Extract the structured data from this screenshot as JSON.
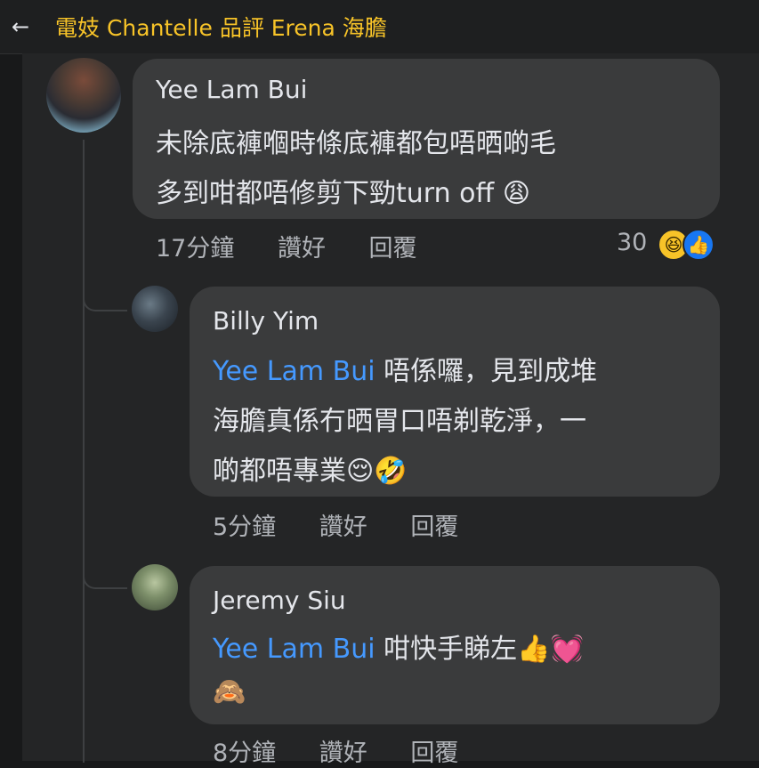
{
  "header": {
    "back_icon": "←",
    "title": "電妓 Chantelle 品評 Erena 海膽"
  },
  "comment": {
    "author": "Yee Lam Bui",
    "lines": [
      "未除底褲嗰時條底褲都包唔晒啲毛",
      "多到咁都唔￼修剪下勁turn off"
    ],
    "emoji_end": "😩",
    "time": "17分鐘",
    "like_label": "讚好",
    "reply_label": "回覆",
    "reaction_count": "30",
    "reaction_icons": [
      "laugh-icon",
      "like-icon"
    ]
  },
  "replies": [
    {
      "author": "Billy Yim",
      "mention": "Yee Lam Bui",
      "lines": [
        " 唔係囉，見到成堆",
        "海膽真係冇晒胃口唔剃乾淨，一",
        "啲都唔專業"
      ],
      "emoji_end": "😌🤣",
      "time": "5分鐘",
      "like_label": "讚好",
      "reply_label": "回覆"
    },
    {
      "author": "Jeremy Siu",
      "mention": "Yee Lam Bui",
      "lines": [
        " 咁快手睇左"
      ],
      "emoji_line1": "👍💓",
      "emoji_line2": "🙈",
      "time": "8分鐘",
      "like_label": "讚好",
      "reply_label": "回覆"
    }
  ]
}
